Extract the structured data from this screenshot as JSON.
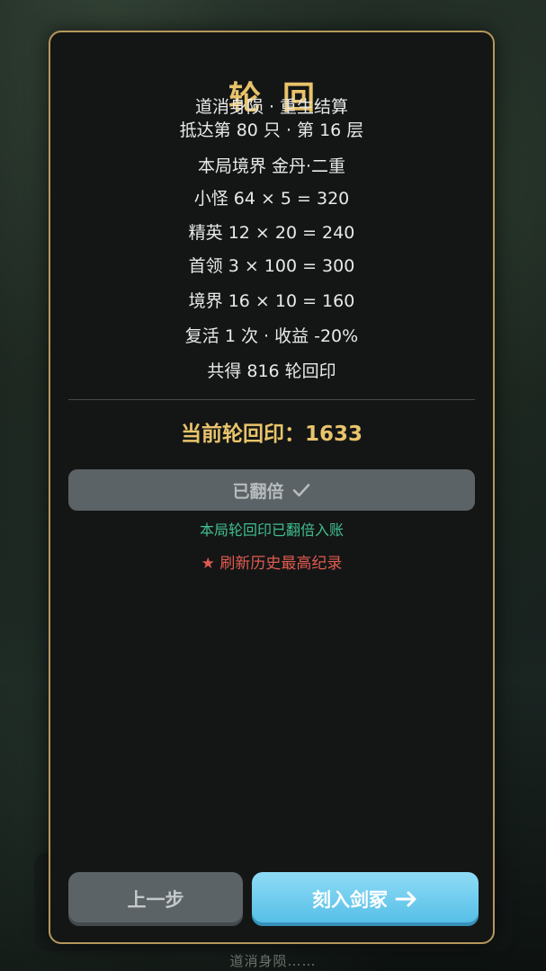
{
  "background": {
    "bottom_text": "道消身陨……"
  },
  "modal": {
    "title": "轮回",
    "subtitle": "道消身陨 · 重生结算",
    "reached": "抵达第 80 只 · 第 16 层",
    "stats": [
      "本局境界 金丹·二重",
      "小怪 64 × 5 = 320",
      "精英 12 × 20 = 240",
      "首领 3 × 100 = 300",
      "境界 16 × 10 = 160",
      "复活 1 次 · 收益 -20%",
      "共得 816 轮回印"
    ],
    "total": "当前轮回印：1633",
    "doubled_button": "已翻倍",
    "doubled_note": "本局轮回印已翻倍入账",
    "record_note": "★ 刷新历史最高纪录",
    "prev_button": "上一步",
    "next_button": "刻入剑冢"
  },
  "colors": {
    "gold": "#e8c36a",
    "border": "#b5985b",
    "green": "#3fbf8f",
    "red": "#e05a4f",
    "primary": "#52bde6",
    "disabled": "#5c6366"
  },
  "icons": {
    "doubled": "check-icon",
    "next": "arrow-right-icon"
  }
}
